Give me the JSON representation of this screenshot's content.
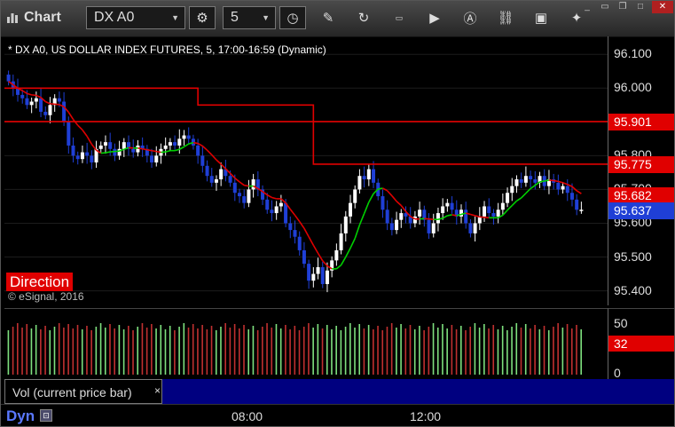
{
  "toolbar": {
    "title": "Chart",
    "symbol": "DX A0",
    "interval": "5"
  },
  "chart": {
    "symbol_line": "* DX A0, US DOLLAR INDEX FUTURES, 5, 17:00-16:59 (Dynamic)",
    "direction_label": "Direction",
    "copyright": "© eSignal, 2016",
    "y_ticks": [
      "96.100",
      "96.000",
      "95.900",
      "95.800",
      "95.700",
      "95.600",
      "95.500",
      "95.400"
    ],
    "price_labels": [
      {
        "text": "95.901",
        "color": "#e00000"
      },
      {
        "text": "95.775",
        "color": "#e00000"
      },
      {
        "text": "95.682",
        "color": "#e00000"
      },
      {
        "text": "95.637",
        "color": "#1f3fd6"
      }
    ]
  },
  "volume": {
    "y_ticks": [
      "50",
      "0"
    ],
    "last_value": "32",
    "legend_label": "Vol (current price bar)",
    "legend_close": "×"
  },
  "bottom": {
    "mode": "Dyn",
    "x_ticks": [
      "08:00",
      "12:00"
    ]
  },
  "colors": {
    "candle_up": "#ffffff",
    "candle_down": "#1f3fd6",
    "ma_red": "#e00000",
    "ma_green": "#00d000",
    "vol_up": "#7ee07e",
    "vol_down": "#c03030"
  },
  "chart_data": {
    "type": "candlestick",
    "ylim": [
      95.37,
      96.14
    ],
    "closes": [
      96.02,
      96.0,
      95.98,
      95.97,
      95.95,
      95.96,
      95.97,
      95.93,
      95.92,
      95.95,
      95.97,
      95.96,
      95.9,
      95.83,
      95.8,
      95.79,
      95.81,
      95.8,
      95.78,
      95.82,
      95.83,
      95.84,
      95.82,
      95.8,
      95.82,
      95.84,
      95.82,
      95.81,
      95.83,
      95.82,
      95.8,
      95.78,
      95.8,
      95.82,
      95.83,
      95.84,
      95.83,
      95.85,
      95.86,
      95.85,
      95.83,
      95.8,
      95.77,
      95.74,
      95.72,
      95.73,
      95.76,
      95.74,
      95.72,
      95.69,
      95.68,
      95.66,
      95.7,
      95.73,
      95.7,
      95.67,
      95.64,
      95.63,
      95.65,
      95.66,
      95.6,
      95.58,
      95.56,
      95.52,
      95.48,
      95.43,
      95.45,
      95.47,
      95.42,
      95.46,
      95.49,
      95.52,
      95.57,
      95.62,
      95.66,
      95.7,
      95.74,
      95.73,
      95.76,
      95.72,
      95.68,
      95.64,
      95.6,
      95.58,
      95.61,
      95.63,
      95.62,
      95.6,
      95.62,
      95.64,
      95.61,
      95.57,
      95.6,
      95.63,
      95.65,
      95.66,
      95.64,
      95.62,
      95.64,
      95.6,
      95.57,
      95.6,
      95.62,
      95.65,
      95.63,
      95.62,
      95.64,
      95.66,
      95.69,
      95.71,
      95.73,
      95.72,
      95.74,
      95.73,
      95.72,
      95.74,
      95.71,
      95.73,
      95.72,
      95.7,
      95.71,
      95.69,
      95.67,
      95.64,
      95.64
    ]
  }
}
